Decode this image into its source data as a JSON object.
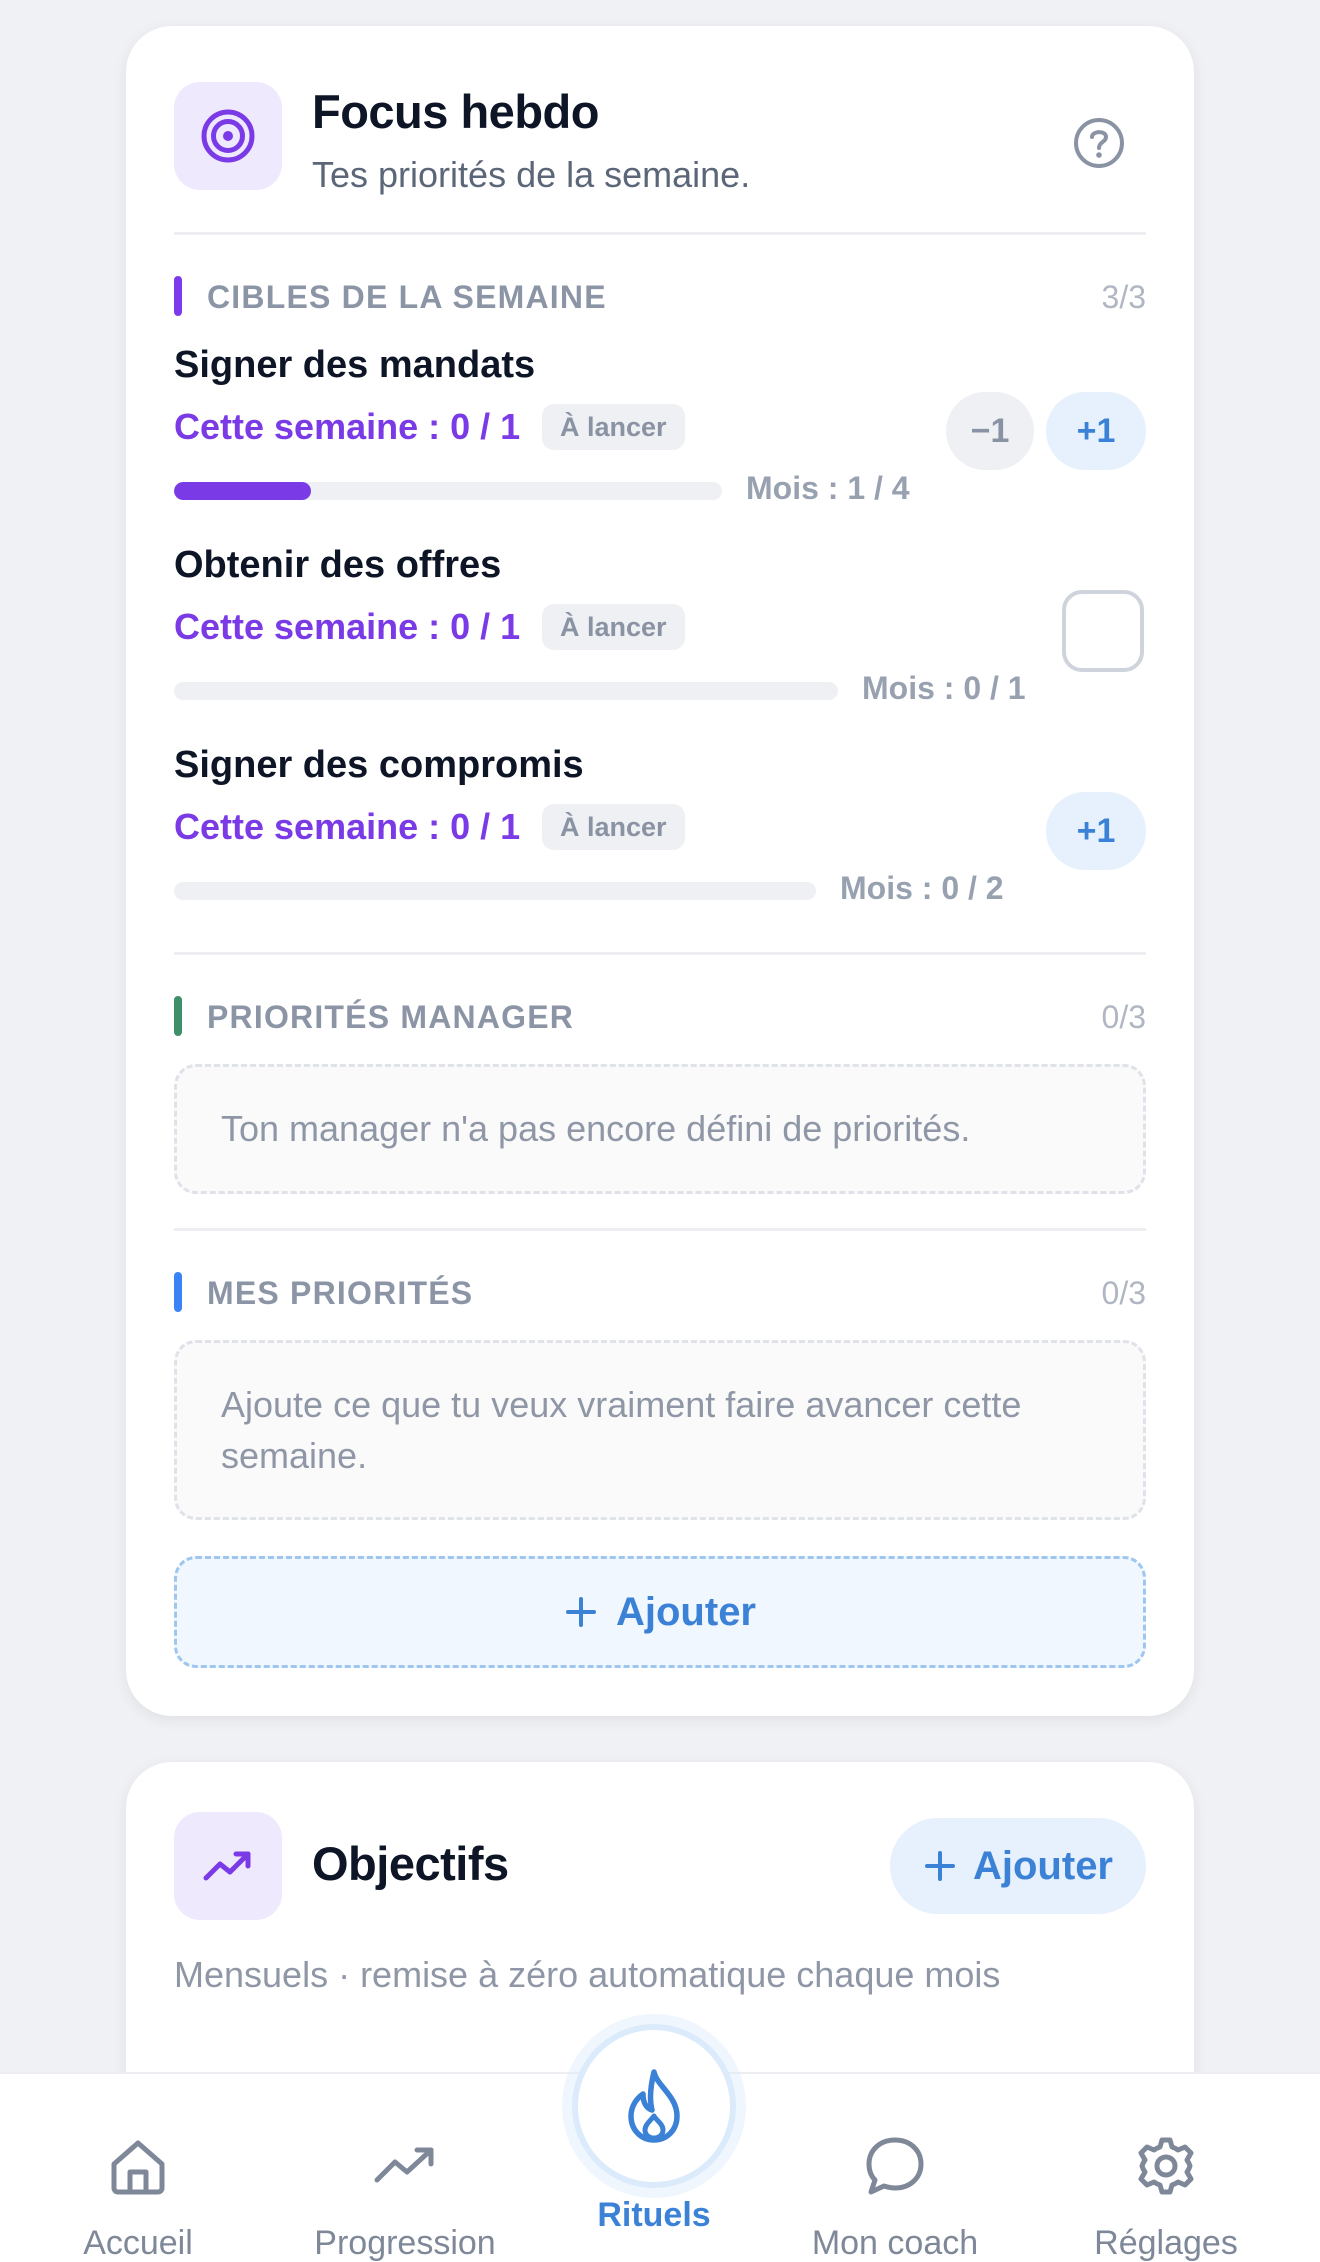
{
  "focus": {
    "title": "Focus hebdo",
    "subtitle": "Tes priorités de la semaine.",
    "targets_section": {
      "title": "CIBLES DE LA SEMAINE",
      "count": "3/3",
      "bar_color": "#7c3aed",
      "goals": [
        {
          "name": "Signer des mandats",
          "week": "Cette semaine : 0 / 1",
          "status": "À lancer",
          "month": "Mois : 1 / 4",
          "month_progress": 0.25,
          "minus_label": "−1",
          "plus_label": "+1"
        },
        {
          "name": "Obtenir des offres",
          "week": "Cette semaine : 0 / 1",
          "status": "À lancer",
          "month": "Mois : 0 / 1",
          "month_progress": 0
        },
        {
          "name": "Signer des compromis",
          "week": "Cette semaine : 0 / 1",
          "status": "À lancer",
          "month": "Mois : 0 / 2",
          "month_progress": 0,
          "plus_label": "+1"
        }
      ]
    },
    "manager_section": {
      "title": "PRIORITÉS MANAGER",
      "count": "0/3",
      "bar_color": "#3f8f6b",
      "empty_text": "Ton manager n'a pas encore défini de priorités."
    },
    "mine_section": {
      "title": "MES PRIORITÉS",
      "count": "0/3",
      "bar_color": "#3b82f6",
      "empty_text": "Ajoute ce que tu veux vraiment faire avancer cette semaine.",
      "add_label": "Ajouter"
    }
  },
  "objectives": {
    "title": "Objectifs",
    "add_label": "Ajouter",
    "caption": "Mensuels · remise à zéro automatique chaque mois"
  },
  "nav": {
    "items": [
      {
        "label": "Accueil",
        "icon": "home-icon"
      },
      {
        "label": "Progression",
        "icon": "trending-up-icon"
      },
      {
        "label": "Rituels",
        "icon": "flame-icon",
        "active": true
      },
      {
        "label": "Mon coach",
        "icon": "chat-bubble-icon"
      },
      {
        "label": "Réglages",
        "icon": "gear-icon"
      }
    ]
  },
  "colors": {
    "accent_purple": "#7a3be6",
    "accent_blue": "#3b82d6",
    "background": "#f0f1f4"
  }
}
